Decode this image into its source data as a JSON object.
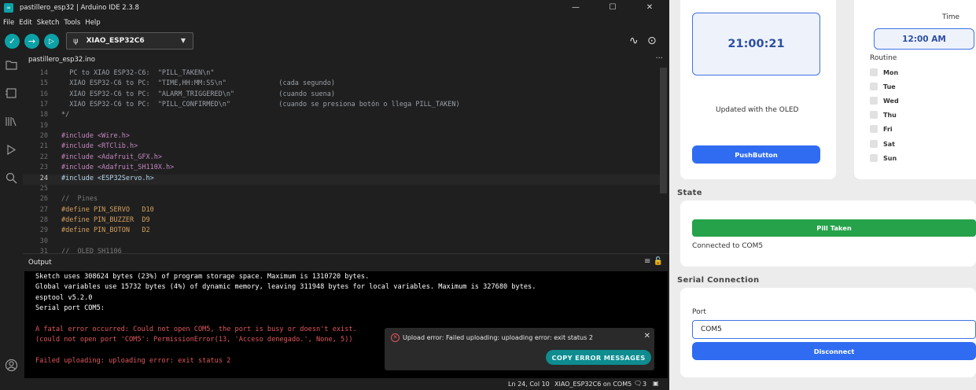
{
  "ide": {
    "title": "pastillero_esp32 | Arduino IDE 2.3.8",
    "app_icon": "∞",
    "window_controls": [
      "—",
      "☐",
      "✕"
    ],
    "menu": [
      "File",
      "Edit",
      "Sketch",
      "Tools",
      "Help"
    ],
    "toolbar": {
      "verify_icon": "✓",
      "upload_icon": "→",
      "debug_icon": "▷",
      "board": "XIAO_ESP32C6",
      "usb_icon": "ψ",
      "caret": "▼",
      "plotter_icon": "∿",
      "monitor_icon": "⊙"
    },
    "sidebar_icons": [
      "sketchbook-icon",
      "boards-icon",
      "library-icon",
      "debug-icon",
      "search-icon",
      "account-icon"
    ],
    "tab": {
      "name": "pastillero_esp32.ino",
      "more": "···"
    },
    "code_lines": [
      {
        "n": "14",
        "text": "  PC to XIAO ESP32-C6:  \"PILL_TAKEN\\n\""
      },
      {
        "n": "15",
        "text": "  XIAO ESP32-C6 to PC:  \"TIME,HH:MM:SS\\n\"             (cada segundo)"
      },
      {
        "n": "16",
        "text": "  XIAO ESP32-C6 to PC:  \"ALARM_TRIGGERED\\n\"           (cuando suena)"
      },
      {
        "n": "17",
        "text": "  XIAO ESP32-C6 to PC:  \"PILL_CONFIRMED\\n\"            (cuando se presiona botón o llega PILL_TAKEN)"
      },
      {
        "n": "18",
        "text": "*/"
      },
      {
        "n": "19",
        "text": ""
      },
      {
        "n": "20",
        "text": "#include <Wire.h>"
      },
      {
        "n": "21",
        "text": "#include <RTClib.h>"
      },
      {
        "n": "22",
        "text": "#include <Adafruit_GFX.h>"
      },
      {
        "n": "23",
        "text": "#include <Adafruit_SH110X.h>"
      },
      {
        "n": "24",
        "text": "#include <ESP32Servo.h>"
      },
      {
        "n": "25",
        "text": ""
      },
      {
        "n": "26",
        "text": "//  Pines"
      },
      {
        "n": "27",
        "text": "#define PIN_SERVO   D10"
      },
      {
        "n": "28",
        "text": "#define PIN_BUZZER  D9"
      },
      {
        "n": "29",
        "text": "#define PIN_BOTON   D2"
      },
      {
        "n": "30",
        "text": ""
      },
      {
        "n": "31",
        "text": "//  OLED SH1106"
      }
    ],
    "output": {
      "label": "Output",
      "icons": "≡ 🔓",
      "lines": [
        {
          "text": "Sketch uses 308624 bytes (23%) of program storage space. Maximum is 1310720 bytes.",
          "color": "#ffffff"
        },
        {
          "text": "Global variables use 15732 bytes (4%) of dynamic memory, leaving 311948 bytes for local variables. Maximum is 327680 bytes.",
          "color": "#ffffff"
        },
        {
          "text": "esptool v5.2.0",
          "color": "#ffffff"
        },
        {
          "text": "Serial port COM5:",
          "color": "#ffffff"
        },
        {
          "text": "",
          "color": "#ffffff"
        },
        {
          "text": "A fatal error occurred: Could not open COM5, the port is busy or doesn't exist.",
          "color": "#e0575b"
        },
        {
          "text": "(could not open port 'COM5': PermissionError(13, 'Acceso denegado.', None, 5))",
          "color": "#e0575b"
        },
        {
          "text": "",
          "color": "#ffffff"
        },
        {
          "text": "Failed uploading: uploading error: exit status 2",
          "color": "#e0575b"
        }
      ]
    },
    "toast": {
      "message": "Upload error: Failed uploading: uploading error: exit status 2",
      "close": "✕",
      "button": "COPY ERROR MESSAGES",
      "error_icon": "✕"
    },
    "status": {
      "position": "Ln 24, Col 10",
      "board_port": "XIAO_ESP32C6 on COM5",
      "notifications": "3",
      "notif_icon": "🗨",
      "layout_icon": "▣"
    }
  },
  "app": {
    "clock": "21:00:21",
    "oled_note": "Updated with the OLED",
    "push_button": "PushButton",
    "time_label": "Time",
    "time_value": "12:00 AM",
    "routine_label": "Routine",
    "days": [
      "Mon",
      "Tue",
      "Wed",
      "Thu",
      "Fri",
      "Sat",
      "Sun"
    ],
    "state_title": "State",
    "pill_taken": "Pill Taken",
    "connected_text": "Connected to COM5",
    "serial_title": "Serial Connection",
    "port_label": "Port",
    "port_value": "COM5",
    "disconnect": "Disconnect",
    "colors": {
      "accent": "#2f6cf2",
      "success": "#25a24a",
      "error": "#e0575b",
      "arduino_teal": "#0ca1a6"
    }
  }
}
